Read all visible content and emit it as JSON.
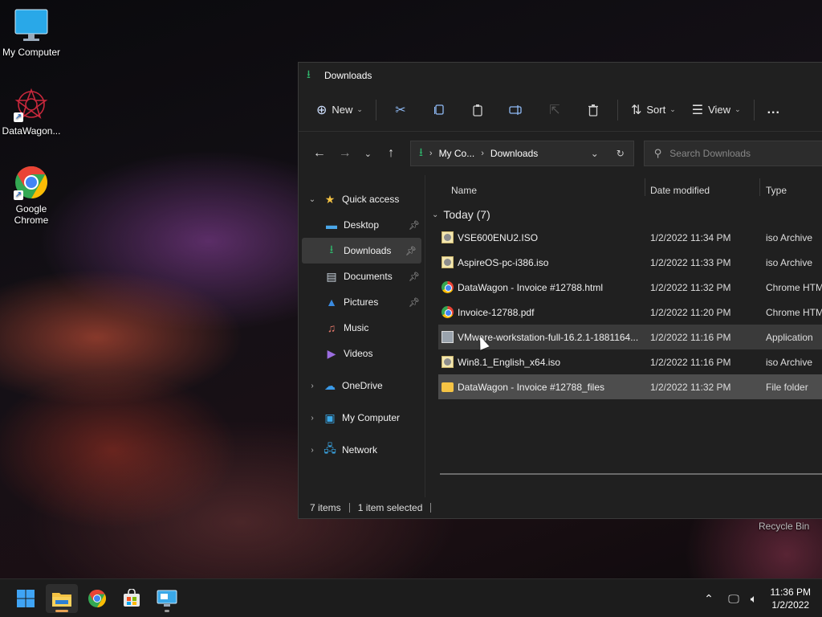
{
  "desktop": {
    "icons": [
      {
        "label": "My Computer",
        "icon": "monitor-icon"
      },
      {
        "label": "DataWagon...",
        "icon": "datawagon-logo-icon"
      },
      {
        "label": "Google\nChrome",
        "icon": "chrome-icon"
      }
    ],
    "recycle_bin_label": "Recycle Bin"
  },
  "window": {
    "title": "Downloads",
    "toolbar": {
      "new_label": "New",
      "sort_label": "Sort",
      "view_label": "View",
      "more_label": "..."
    },
    "address": {
      "crumb_1": "My Co...",
      "crumb_2": "Downloads"
    },
    "search": {
      "placeholder": "Search Downloads"
    },
    "navpane": {
      "quick_access": "Quick access",
      "items": [
        {
          "label": "Desktop",
          "icon": "desktop-icon",
          "pinned": true
        },
        {
          "label": "Downloads",
          "icon": "download-icon",
          "pinned": true
        },
        {
          "label": "Documents",
          "icon": "documents-icon",
          "pinned": true
        },
        {
          "label": "Pictures",
          "icon": "pictures-icon",
          "pinned": true
        },
        {
          "label": "Music",
          "icon": "music-icon",
          "pinned": false
        },
        {
          "label": "Videos",
          "icon": "videos-icon",
          "pinned": false
        }
      ],
      "onedrive": "OneDrive",
      "my_computer": "My Computer",
      "network": "Network"
    },
    "columns": {
      "name": "Name",
      "date": "Date modified",
      "type": "Type"
    },
    "group": {
      "label": "Today (7)"
    },
    "files": [
      {
        "name": "VSE600ENU2.ISO",
        "date": "1/2/2022 11:34 PM",
        "type": "iso Archive",
        "icon": "iso"
      },
      {
        "name": "AspireOS-pc-i386.iso",
        "date": "1/2/2022 11:33 PM",
        "type": "iso Archive",
        "icon": "iso"
      },
      {
        "name": "DataWagon - Invoice #12788.html",
        "date": "1/2/2022 11:32 PM",
        "type": "Chrome HTM",
        "icon": "chrome"
      },
      {
        "name": "Invoice-12788.pdf",
        "date": "1/2/2022 11:20 PM",
        "type": "Chrome HTM",
        "icon": "chrome"
      },
      {
        "name": "VMware-workstation-full-16.2.1-1881164...",
        "date": "1/2/2022 11:16 PM",
        "type": "Application",
        "icon": "app"
      },
      {
        "name": "Win8.1_English_x64.iso",
        "date": "1/2/2022 11:16 PM",
        "type": "iso Archive",
        "icon": "iso"
      },
      {
        "name": "DataWagon - Invoice #12788_files",
        "date": "1/2/2022 11:32 PM",
        "type": "File folder",
        "icon": "folder"
      }
    ],
    "status": {
      "items": "7 items",
      "selected": "1 item selected"
    }
  },
  "taskbar": {
    "apps": [
      "start-icon",
      "file-explorer-icon",
      "chrome-icon",
      "store-icon",
      "remote-desktop-icon"
    ],
    "clock_time": "11:36 PM",
    "clock_date": "1/2/2022"
  }
}
